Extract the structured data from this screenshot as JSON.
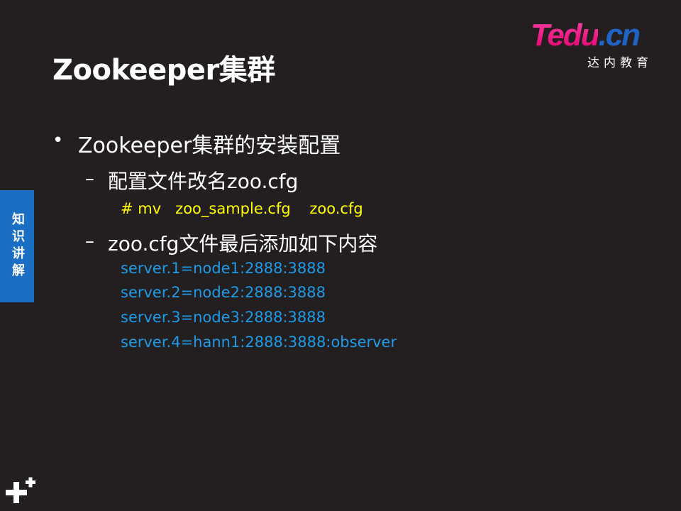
{
  "slide": {
    "title": "Zookeeper集群"
  },
  "logo": {
    "brand_pink": "Tedu",
    "brand_blue": ".cn",
    "subtitle": "达内教育"
  },
  "side_tab": {
    "label": "知识讲解"
  },
  "content": {
    "bullet": "Zookeeper集群的安装配置",
    "sub1": "配置文件改名zoo.cfg",
    "cmd": "# mv   zoo_sample.cfg    zoo.cfg",
    "sub2": "zoo.cfg文件最后添加如下内容",
    "servers": [
      "server.1=node1:2888:3888",
      "server.2=node2:2888:3888",
      "server.3=node3:2888:3888",
      "server.4=hann1:2888:3888:observer"
    ]
  },
  "colors": {
    "background": "#231f20",
    "command": "#ffff00",
    "config": "#1e9be6",
    "tab": "#1a6fc4"
  },
  "icons": {
    "corner": "plus-plus-icon"
  }
}
